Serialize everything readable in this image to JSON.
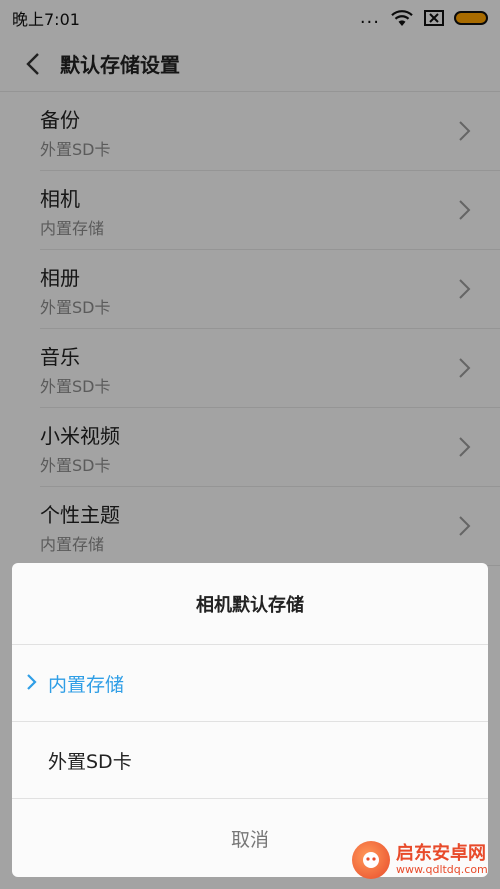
{
  "statusbar": {
    "time": "晚上7:01",
    "dots": "..."
  },
  "titlebar": {
    "title": "默认存储设置"
  },
  "list": [
    {
      "title": "备份",
      "subtitle": "外置SD卡"
    },
    {
      "title": "相机",
      "subtitle": "内置存储"
    },
    {
      "title": "相册",
      "subtitle": "外置SD卡"
    },
    {
      "title": "音乐",
      "subtitle": "外置SD卡"
    },
    {
      "title": "小米视频",
      "subtitle": "外置SD卡"
    },
    {
      "title": "个性主题",
      "subtitle": "内置存储"
    }
  ],
  "dialog": {
    "title": "相机默认存储",
    "options": [
      {
        "label": "内置存储",
        "selected": true
      },
      {
        "label": "外置SD卡",
        "selected": false
      }
    ],
    "cancel_label": "取消"
  },
  "watermark": {
    "brand": "启东安卓网",
    "url": "www.qdltdq.com"
  },
  "colors": {
    "accent": "#2f9ee6",
    "battery": "#ffa300",
    "watermark": "#e84a2a"
  }
}
